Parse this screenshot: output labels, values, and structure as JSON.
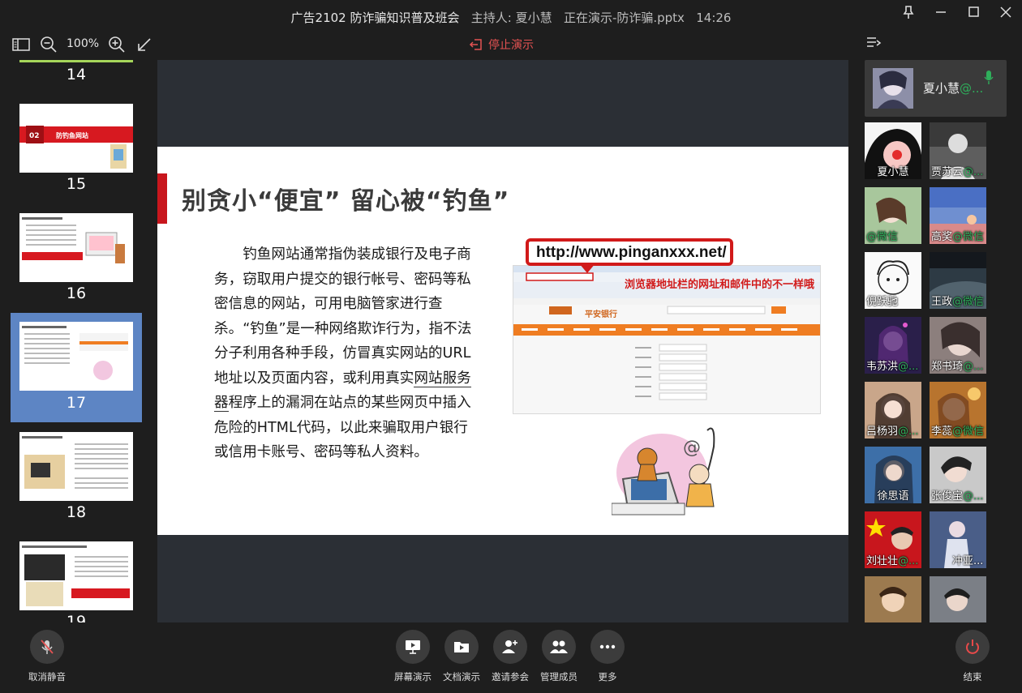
{
  "window": {
    "meeting_title": "广告2102 防诈骗知识普及班会",
    "host_label": "主持人: 夏小慧",
    "presenting_label": "正在演示-防诈骗.pptx",
    "time": "14:26"
  },
  "toolbar": {
    "zoom_level": "100%",
    "stop_presenting_label": "停止演示"
  },
  "thumbnails": [
    {
      "number": "14",
      "active": false
    },
    {
      "number": "15",
      "active": false
    },
    {
      "number": "16",
      "active": false
    },
    {
      "number": "17",
      "active": true
    },
    {
      "number": "18",
      "active": false
    },
    {
      "number": "19",
      "active": false
    }
  ],
  "slide": {
    "title": "别贪小“便宜” 留心被“钓鱼”",
    "body_before_underline": "钓鱼网站通常指伪装成银行及电子商务，窃取用户提交的银行帐号、密码等私密信息的网站，可用电脑管家进行查杀。“钓鱼”是一种网络欺诈行为，指不法分子利用各种手段，仿冒真实网站的URL地址以及页面内容，或利用真实",
    "body_underlined": "网站服务器",
    "body_after_underline": "程序上的漏洞在站点的某些网页中插入危险的HTML代码，以此来骗取用户银行或信用卡账号、密码等私人资料。",
    "url_callout": "http://www.pinganxxx.net/",
    "browser_caption": "浏览器地址栏的网址和邮件中的不一样哦",
    "bank_name": "平安银行"
  },
  "host": {
    "name": "夏小慧",
    "suffix": "@..."
  },
  "participants": [
    {
      "name": "夏小慧",
      "suffix": ""
    },
    {
      "name": "贾苏云",
      "suffix": "@..."
    },
    {
      "name": "",
      "suffix": "@微信"
    },
    {
      "name": "高奖",
      "suffix": "@微信"
    },
    {
      "name": "倪跃驰",
      "suffix": ""
    },
    {
      "name": "王政",
      "suffix": "@微信"
    },
    {
      "name": "韦苏洪",
      "suffix": "@..."
    },
    {
      "name": "郑书琦",
      "suffix": "@..."
    },
    {
      "name": "吕杨羽",
      "suffix": "@..."
    },
    {
      "name": "李蕊",
      "suffix": "@微信"
    },
    {
      "name": "徐思语",
      "suffix": ""
    },
    {
      "name": "张俊宝",
      "suffix": "@..."
    },
    {
      "name": "刘壮壮",
      "suffix": "@..."
    },
    {
      "name": "冲亚...",
      "suffix": ""
    }
  ],
  "bottom_bar": {
    "unmute": "取消静音",
    "screen_share": "屏幕演示",
    "doc_share": "文档演示",
    "invite": "邀请参会",
    "manage_members": "管理成员",
    "more": "更多",
    "end": "结束"
  },
  "colors": {
    "stop_red": "#e45252",
    "active_thumb": "#5d85c4",
    "wechat_green": "#2fae5b",
    "slide_accent_red": "#c8161d"
  }
}
